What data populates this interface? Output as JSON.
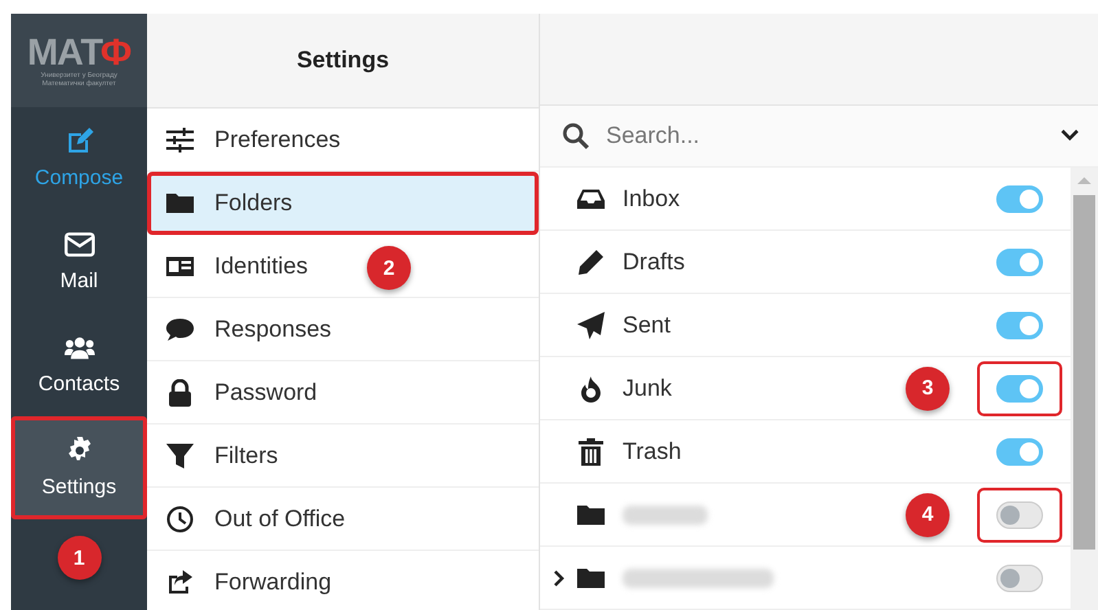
{
  "logo": {
    "text": "МАТ",
    "accent": "Ф",
    "subtitle": [
      "Универзитет у Београду",
      "Математички факултет"
    ]
  },
  "nav": [
    {
      "label": "Compose",
      "highlighted": true,
      "selected": false,
      "annotated": false
    },
    {
      "label": "Mail",
      "highlighted": false,
      "selected": false,
      "annotated": false
    },
    {
      "label": "Contacts",
      "highlighted": false,
      "selected": false,
      "annotated": false
    },
    {
      "label": "Settings",
      "highlighted": false,
      "selected": true,
      "annotated": true
    }
  ],
  "nav_callout": "1",
  "settings": {
    "title": "Settings",
    "items": [
      {
        "label": "Preferences",
        "selected": false,
        "annotated": false
      },
      {
        "label": "Folders",
        "selected": true,
        "annotated": true
      },
      {
        "label": "Identities",
        "selected": false,
        "annotated": false,
        "callout": "2"
      },
      {
        "label": "Responses",
        "selected": false,
        "annotated": false
      },
      {
        "label": "Password",
        "selected": false,
        "annotated": false
      },
      {
        "label": "Filters",
        "selected": false,
        "annotated": false
      },
      {
        "label": "Out of Office",
        "selected": false,
        "annotated": false
      },
      {
        "label": "Forwarding",
        "selected": false,
        "annotated": false
      }
    ]
  },
  "search": {
    "placeholder": "Search..."
  },
  "folders": [
    {
      "label": "Inbox",
      "on": true,
      "annotated": false
    },
    {
      "label": "Drafts",
      "on": true,
      "annotated": false
    },
    {
      "label": "Sent",
      "on": true,
      "annotated": false
    },
    {
      "label": "Junk",
      "on": true,
      "annotated": true,
      "callout": "3"
    },
    {
      "label": "Trash",
      "on": true,
      "annotated": false
    },
    {
      "on": false,
      "annotated": true,
      "callout": "4"
    },
    {
      "on": false,
      "annotated": false,
      "expandable": true
    }
  ]
}
